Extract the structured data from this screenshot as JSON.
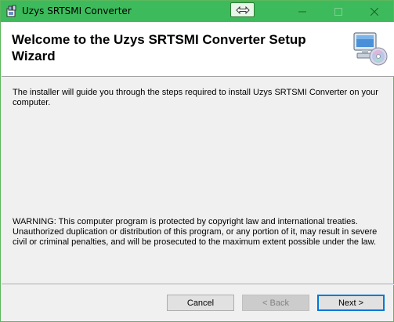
{
  "window": {
    "title": "Uzys SRTSMI Converter",
    "accent": "#3dbb5c"
  },
  "header": {
    "title": "Welcome to the Uzys SRTSMI Converter Setup Wizard",
    "icon": "computer-cd-icon"
  },
  "content": {
    "intro": "The installer will guide you through the steps required to install Uzys SRTSMI Converter on your computer.",
    "warning": "WARNING: This computer program is protected by copyright law and international treaties. Unauthorized duplication or distribution of this program, or any portion of it, may result in severe civil or criminal penalties, and will be prosecuted to the maximum extent possible under the law."
  },
  "buttons": {
    "cancel": "Cancel",
    "back": "< Back",
    "next": "Next >"
  }
}
